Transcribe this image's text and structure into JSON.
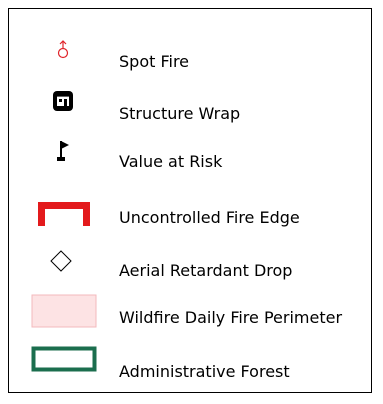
{
  "legend": {
    "items": [
      {
        "label": "Spot Fire",
        "icon": "spot-fire-icon",
        "color": "#e0242a"
      },
      {
        "label": "Structure Wrap",
        "icon": "structure-wrap-icon",
        "color": "#000000"
      },
      {
        "label": "Value at Risk",
        "icon": "value-at-risk-flag-icon",
        "color": "#000000"
      },
      {
        "label": "Uncontrolled Fire Edge",
        "icon": "uncontrolled-fire-edge-symbol",
        "color": "#e31a1c"
      },
      {
        "label": "Aerial Retardant Drop",
        "icon": "aerial-retardant-drop-diamond-icon",
        "color": "#000000"
      },
      {
        "label": "Wildfire Daily Fire Perimeter",
        "icon": "wildfire-daily-fire-perimeter-swatch",
        "color": "#fde3e4"
      },
      {
        "label": "Administrative Forest",
        "icon": "administrative-forest-swatch",
        "color": "#1b6e4e"
      }
    ]
  }
}
